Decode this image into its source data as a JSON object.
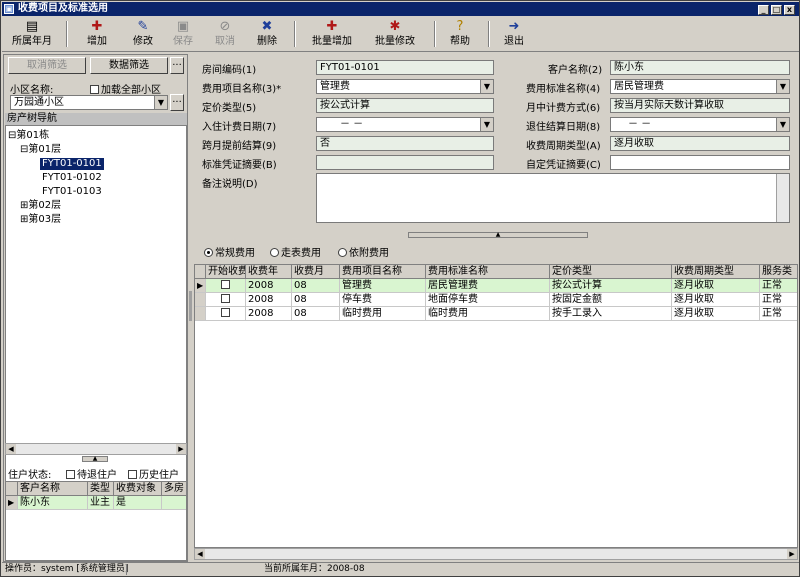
{
  "window": {
    "title": "收费项目及标准选用",
    "min": "_",
    "max": "□",
    "close": "x"
  },
  "toolbar": [
    {
      "label": "所属年月",
      "icon": "calendar-icon",
      "glyph": "▤",
      "disabled": false
    },
    {
      "label": "增加",
      "icon": "add-icon",
      "glyph": "✚",
      "disabled": false
    },
    {
      "label": "修改",
      "icon": "edit-icon",
      "glyph": "✎",
      "disabled": false
    },
    {
      "label": "保存",
      "icon": "save-icon",
      "glyph": "▣",
      "disabled": true
    },
    {
      "label": "取消",
      "icon": "cancel-icon",
      "glyph": "⊘",
      "disabled": true
    },
    {
      "label": "删除",
      "icon": "delete-icon",
      "glyph": "✖",
      "disabled": false
    },
    {
      "label": "批量增加",
      "icon": "batch-add-icon",
      "glyph": "✚",
      "disabled": false
    },
    {
      "label": "批量修改",
      "icon": "batch-edit-icon",
      "glyph": "✱",
      "disabled": false
    },
    {
      "label": "帮助",
      "icon": "help-icon",
      "glyph": "?",
      "disabled": false
    },
    {
      "label": "退出",
      "icon": "exit-icon",
      "glyph": "➜",
      "disabled": false
    }
  ],
  "left": {
    "cancel_filter": "取消筛选",
    "data_filter": "数据筛选",
    "more": "···",
    "community_label": "小区名称:",
    "load_all_label": "加载全部小区",
    "community_value": "万园通小区",
    "tree_header": "房产树导航",
    "tree": [
      {
        "text": "第01栋",
        "prefix": "⊟"
      },
      {
        "text": "第01层",
        "prefix": "⊟"
      },
      {
        "text": "FYT01-0101",
        "prefix": ""
      },
      {
        "text": "FYT01-0102",
        "prefix": ""
      },
      {
        "text": "FYT01-0103",
        "prefix": ""
      },
      {
        "text": "第02层",
        "prefix": "⊞"
      },
      {
        "text": "第03层",
        "prefix": "⊞"
      }
    ],
    "resident_status_label": "住户状态:",
    "pending_label": "待退住户",
    "history_label": "历史住户",
    "resident_grid": {
      "headers": [
        "客户名称",
        "类型",
        "收费对象",
        "多房"
      ],
      "rows": [
        [
          "陈小东",
          "业主",
          "是",
          ""
        ]
      ]
    }
  },
  "form": {
    "room_no_label": "房间编码(1)",
    "room_no": "FYT01-0101",
    "customer_label": "客户名称(2)",
    "customer": "陈小东",
    "fee_item_label": "费用项目名称(3)*",
    "fee_item": "管理费",
    "fee_std_label": "费用标准名称(4)",
    "fee_std": "居民管理费",
    "price_type_label": "定价类型(5)",
    "price_type": "按公式计算",
    "month_calc_label": "月中计费方式(6)",
    "month_calc": "按当月实际天数计算收取",
    "checkin_label": "入住计费日期(7)",
    "checkin": "－  －",
    "checkout_label": "退住结算日期(8)",
    "checkout": "－  －",
    "cross_month_label": "跨月提前结算(9)",
    "cross_month": "否",
    "cycle_label": "收费周期类型(A)",
    "cycle": "逐月收取",
    "voucher_label": "标准凭证摘要(B)",
    "voucher": "",
    "custom_voucher_label": "自定凭证摘要(C)",
    "custom_voucher": "",
    "remark_label": "备注说明(D)",
    "remark": ""
  },
  "tabs": [
    {
      "label": "常规费用",
      "on": true
    },
    {
      "label": "走表费用",
      "on": false
    },
    {
      "label": "依附费用",
      "on": false
    }
  ],
  "fee_grid": {
    "headers": [
      "开始收费",
      "收费年",
      "收费月",
      "费用项目名称",
      "费用标准名称",
      "定价类型",
      "收费周期类型",
      "服务类"
    ],
    "rows": [
      [
        "",
        "2008",
        "08",
        "管理费",
        "居民管理费",
        "按公式计算",
        "逐月收取",
        "正常"
      ],
      [
        "",
        "2008",
        "08",
        "停车费",
        "地面停车费",
        "按固定金额",
        "逐月收取",
        "正常"
      ],
      [
        "",
        "2008",
        "08",
        "临时费用",
        "临时费用",
        "按手工录入",
        "逐月收取",
        "正常"
      ]
    ]
  },
  "status": {
    "operator": "操作员：system [系统管理员]",
    "current_month": "当前所属年月：2008-08"
  },
  "colors": {
    "title_bg": "#0a246a",
    "field_bg": "#e8efe6",
    "selected_row": "#d9f5d0"
  }
}
